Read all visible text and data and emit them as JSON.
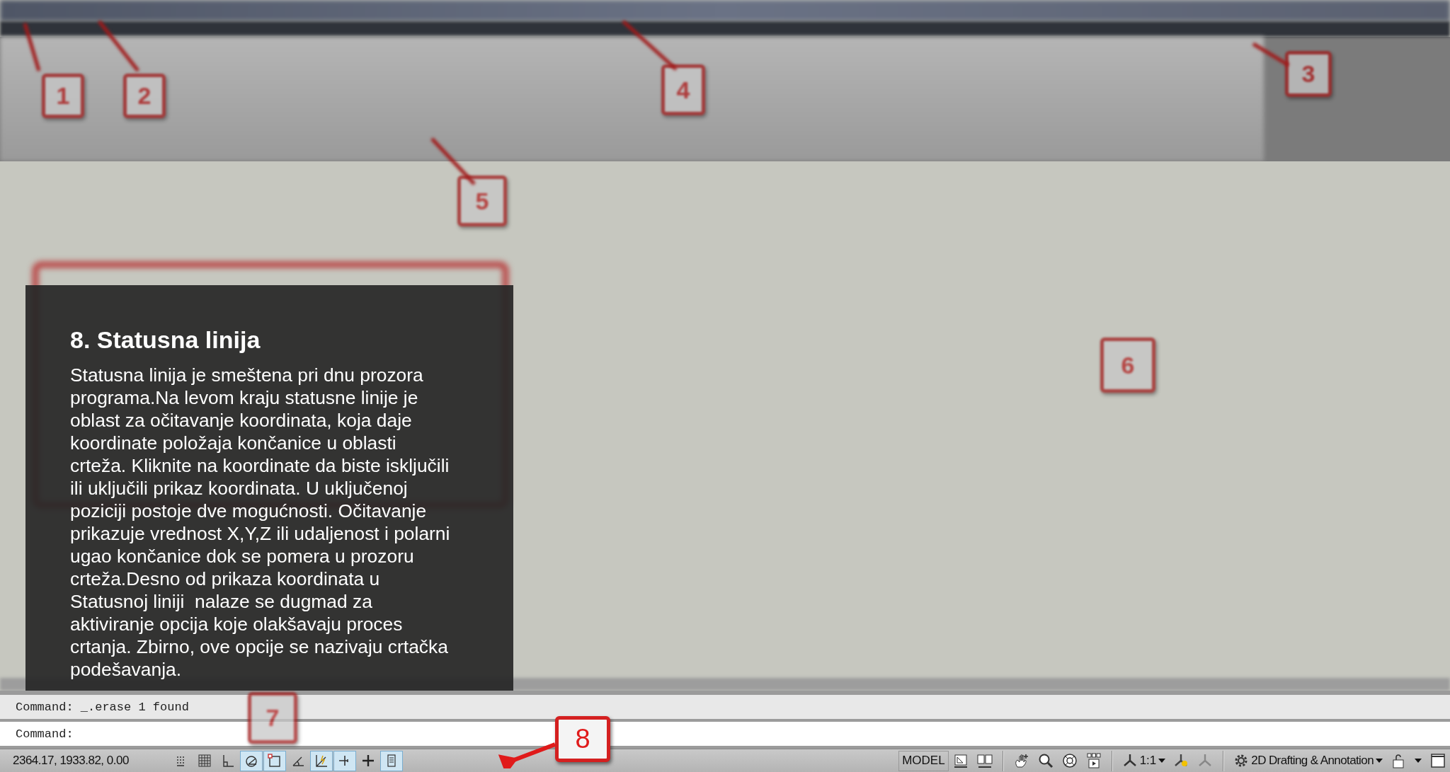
{
  "callouts": [
    {
      "number": "1",
      "kind": "blurred"
    },
    {
      "number": "2",
      "kind": "blurred"
    },
    {
      "number": "3",
      "kind": "blurred"
    },
    {
      "number": "4",
      "kind": "blurred"
    },
    {
      "number": "5",
      "kind": "blurred"
    },
    {
      "number": "6",
      "kind": "blurred"
    },
    {
      "number": "7",
      "kind": "blurred"
    },
    {
      "number": "8",
      "kind": "sharp"
    }
  ],
  "tutorial_panel": {
    "title": "8. Statusna linija",
    "body": "Statusna linija je smeštena pri dnu prozora programa.Na levom kraju statusne linije je oblast za očitavanje koordinata, koja daje koordinate položaja končanice u oblasti crteža. Kliknite na koordinate da biste isključili ili uključili prikaz koordinata. U uključenoj poziciji postoje dve mogućnosti. Očitavanje prikazuje vrednost X,Y,Z ili udaljenost i polarni ugao končanice dok se pomera u prozoru crteža.Desno od prikaza koordinata u Statusnoj liniji  nalaze se dugmad za aktiviranje opcija koje olakšavaju proces crtanja. Zbirno, ove opcije se nazivaju crtačka podešavanja."
  },
  "command_line": {
    "history": "Command: _.erase 1 found",
    "prompt": "Command:"
  },
  "status_bar": {
    "coordinates": "2364.17, 1933.82, 0.00",
    "toggles": [
      {
        "kind": "snap",
        "on": false
      },
      {
        "kind": "grid",
        "on": false
      },
      {
        "kind": "ortho",
        "on": false
      },
      {
        "kind": "polar",
        "on": true
      },
      {
        "kind": "osnap",
        "on": true
      },
      {
        "kind": "otrack",
        "on": false
      },
      {
        "kind": "ducs",
        "on": true
      },
      {
        "kind": "dyn",
        "on": true
      },
      {
        "kind": "lwt",
        "on": false
      },
      {
        "kind": "qp",
        "on": true
      }
    ],
    "model_label": "MODEL",
    "annotation_scale": "1:1",
    "workspace": "2D Drafting & Annotation"
  }
}
